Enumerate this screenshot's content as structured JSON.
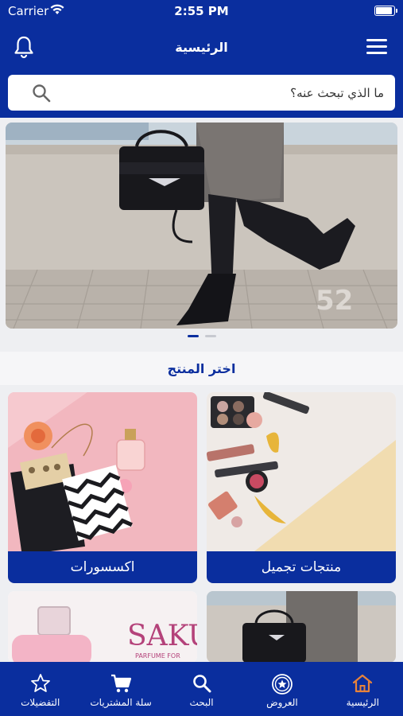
{
  "status": {
    "carrier": "Carrier",
    "time": "2:55 PM"
  },
  "navbar": {
    "title": "الرئيسية",
    "bell_icon": "bell-icon",
    "menu_icon": "hamburger-menu-icon"
  },
  "search": {
    "placeholder": "ما الذي تبحث عنه؟",
    "icon": "search-icon"
  },
  "banner": {
    "image": "woman-with-handbag-and-boots-photo",
    "dots": 2,
    "active_dot": 1
  },
  "section": {
    "title": "اختر المنتج"
  },
  "categories": [
    {
      "label": "منتجات تجميل",
      "image": "cosmetics-photo"
    },
    {
      "label": "اكسسورات",
      "image": "accessories-photo"
    },
    {
      "label": "",
      "image": "bag-photo"
    },
    {
      "label": "",
      "image": "perfume-photo"
    }
  ],
  "perfume_brand": "SAKU",
  "perfume_tagline": "PARFUME FOR",
  "tabbar": {
    "items": [
      {
        "label": "الرئيسية",
        "icon": "home-icon",
        "active": true
      },
      {
        "label": "العروض",
        "icon": "offers-badge-icon",
        "active": false
      },
      {
        "label": "البحث",
        "icon": "search-icon",
        "active": false
      },
      {
        "label": "سلة المشتريات",
        "icon": "cart-icon",
        "active": false
      },
      {
        "label": "التفضيلات",
        "icon": "star-icon",
        "active": false
      }
    ]
  },
  "colors": {
    "primary": "#0a2e9e",
    "active_tab": "#e8833a"
  }
}
